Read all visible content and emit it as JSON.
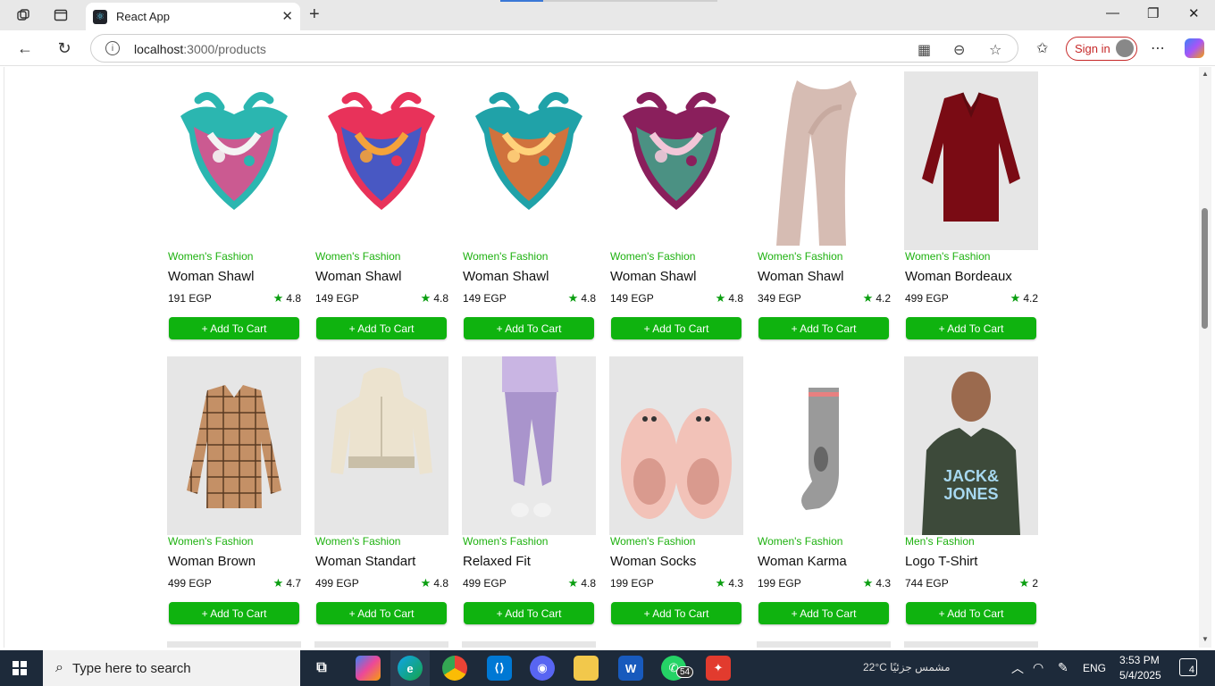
{
  "browser": {
    "tab_title": "React App",
    "tab_favicon": "⚛",
    "url_host": "localhost",
    "url_path": ":3000/products",
    "signin_label": "Sign in"
  },
  "products": [
    {
      "category": "Women's Fashion",
      "name": "Woman Shawl",
      "price": "191 EGP",
      "rating": "4.8",
      "button": "+ Add To Cart",
      "image": "scarf",
      "colors": [
        "#2bb6b0",
        "#e84a8c",
        "#f4f4f4"
      ]
    },
    {
      "category": "Women's Fashion",
      "name": "Woman Shawl",
      "price": "149 EGP",
      "rating": "4.8",
      "button": "+ Add To Cart",
      "image": "scarf",
      "colors": [
        "#e8325a",
        "#2c5fd6",
        "#f4a23a"
      ]
    },
    {
      "category": "Women's Fashion",
      "name": "Woman Shawl",
      "price": "149 EGP",
      "rating": "4.8",
      "button": "+ Add To Cart",
      "image": "scarf",
      "colors": [
        "#20a2a8",
        "#f06a2a",
        "#ffd27a"
      ]
    },
    {
      "category": "Women's Fashion",
      "name": "Woman Shawl",
      "price": "149 EGP",
      "rating": "4.8",
      "button": "+ Add To Cart",
      "image": "scarf",
      "colors": [
        "#8a1f5c",
        "#3fa68a",
        "#f2c6d8"
      ]
    },
    {
      "category": "Women's Fashion",
      "name": "Woman Shawl",
      "price": "349 EGP",
      "rating": "4.2",
      "button": "+ Add To Cart",
      "image": "long-scarf",
      "colors": [
        "#d6bcb3",
        "#c7aaa0",
        "#ffffff"
      ]
    },
    {
      "category": "Women's Fashion",
      "name": "Woman Bordeaux",
      "price": "499 EGP",
      "rating": "4.2",
      "button": "+ Add To Cart",
      "image": "shirt",
      "colors": [
        "#7a0b14",
        "#e6e6e6",
        "#5e0a10"
      ]
    },
    {
      "category": "Women's Fashion",
      "name": "Woman Brown",
      "price": "499 EGP",
      "rating": "4.7",
      "button": "+ Add To Cart",
      "image": "plaid-shirt",
      "colors": [
        "#c49066",
        "#e6e6e6",
        "#5a3a22"
      ]
    },
    {
      "category": "Women's Fashion",
      "name": "Woman Standart",
      "price": "499 EGP",
      "rating": "4.8",
      "button": "+ Add To Cart",
      "image": "hoodie",
      "colors": [
        "#ece3cf",
        "#e6e6e6",
        "#c9bfa8"
      ]
    },
    {
      "category": "Women's Fashion",
      "name": "Relaxed Fit",
      "price": "499 EGP",
      "rating": "4.8",
      "button": "+ Add To Cart",
      "image": "joggers",
      "colors": [
        "#c9b5e3",
        "#e9e9e9",
        "#a994cc"
      ]
    },
    {
      "category": "Women's Fashion",
      "name": "Woman Socks",
      "price": "199 EGP",
      "rating": "4.3",
      "button": "+ Add To Cart",
      "image": "slippers",
      "colors": [
        "#f2c2b8",
        "#e6e6e6",
        "#d99a8e"
      ]
    },
    {
      "category": "Women's Fashion",
      "name": "Woman Karma",
      "price": "199 EGP",
      "rating": "4.3",
      "button": "+ Add To Cart",
      "image": "sock",
      "colors": [
        "#9a9a9a",
        "#ffffff",
        "#e88080"
      ]
    },
    {
      "category": "Men's Fashion",
      "name": "Logo T-Shirt",
      "price": "744 EGP",
      "rating": "2",
      "button": "+ Add To Cart",
      "image": "tshirt",
      "colors": [
        "#3d4a3a",
        "#e6e6e6",
        "#a7d8f0"
      ]
    }
  ],
  "taskbar": {
    "search_placeholder": "Type here to search",
    "weather": "22°C  مشمس جزئيًا",
    "language": "ENG",
    "time": "3:53 PM",
    "date": "5/4/2025",
    "whatsapp_badge": "54",
    "notifications": "4"
  },
  "colors": {
    "accent_green": "#0fb30f",
    "category_green": "#1db10f"
  }
}
